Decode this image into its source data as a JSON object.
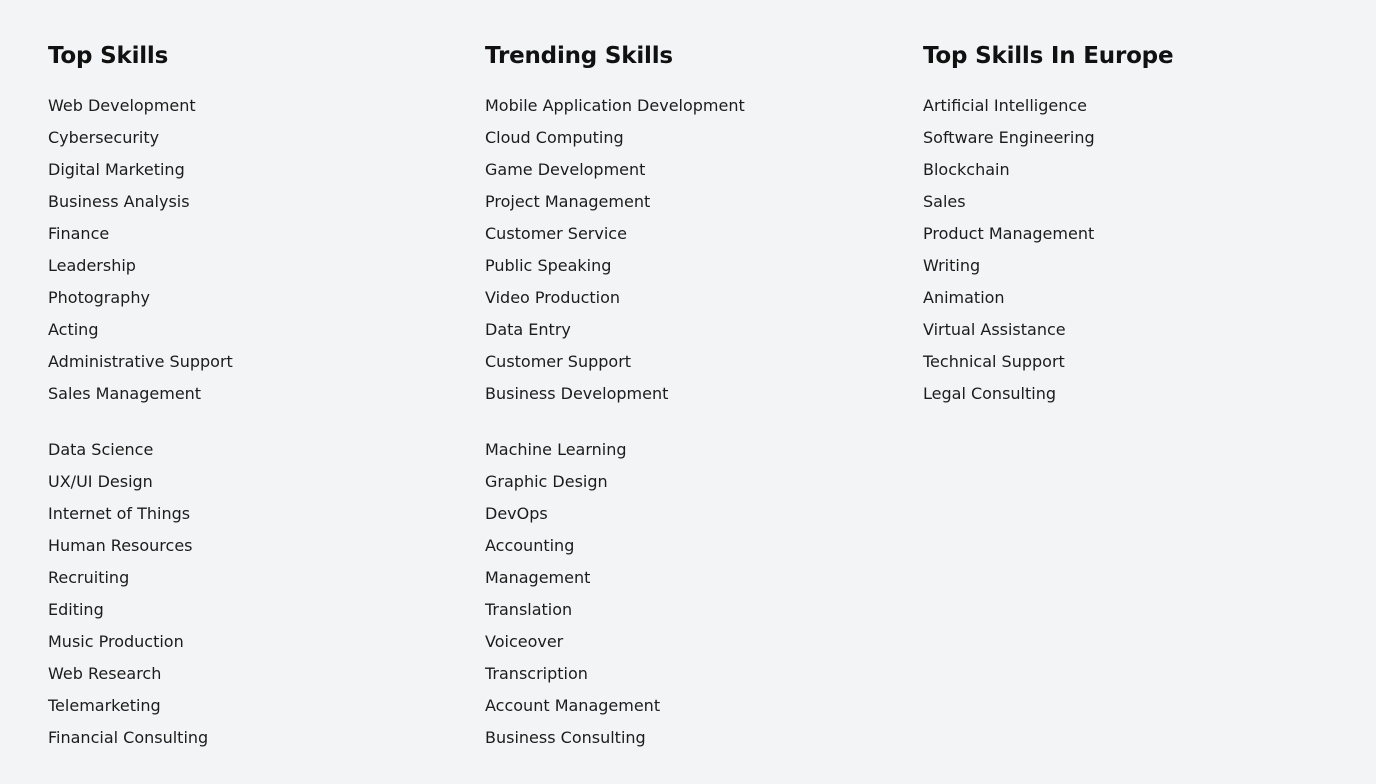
{
  "columns": [
    {
      "title": "Top Skills",
      "groups": [
        [
          "Web Development",
          "Cybersecurity",
          "Digital Marketing",
          "Business Analysis",
          "Finance",
          "Leadership",
          "Photography",
          "Acting",
          "Administrative Support",
          "Sales Management"
        ],
        [
          "Data Science",
          "UX/UI Design",
          "Internet of Things",
          "Human Resources",
          "Recruiting",
          "Editing",
          "Music Production",
          "Web Research",
          "Telemarketing",
          "Financial Consulting"
        ]
      ]
    },
    {
      "title": "Trending Skills",
      "groups": [
        [
          "Mobile Application Development",
          "Cloud Computing",
          "Game Development",
          "Project Management",
          "Customer Service",
          "Public Speaking",
          "Video Production",
          "Data Entry",
          "Customer Support",
          "Business Development"
        ],
        [
          "Machine Learning",
          "Graphic Design",
          "DevOps",
          "Accounting",
          "Management",
          "Translation",
          "Voiceover",
          "Transcription",
          "Account Management",
          "Business Consulting"
        ]
      ]
    },
    {
      "title": "Top Skills In Europe",
      "groups": [
        [
          "Artificial Intelligence",
          "Software Engineering",
          "Blockchain",
          "Sales",
          "Product Management",
          "Writing",
          "Animation",
          "Virtual Assistance",
          "Technical Support",
          "Legal Consulting"
        ]
      ]
    }
  ],
  "colors": {
    "background": "#f2f4f5",
    "text": "#1c1c1c",
    "heading": "#111111"
  }
}
